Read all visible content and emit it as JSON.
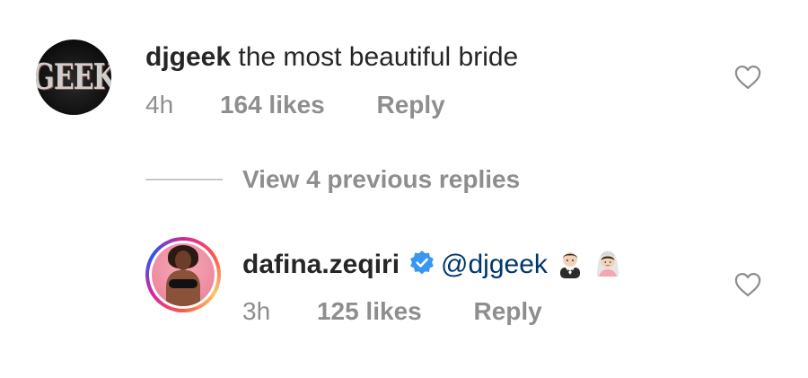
{
  "comments": [
    {
      "username": "djgeek",
      "text": "the most beautiful bride",
      "time": "4h",
      "likes": "164 likes",
      "reply": "Reply",
      "avatar_logo": "GEEK",
      "liked": false
    },
    {
      "username": "dafina.zeqiri",
      "verified": true,
      "mention": "@djgeek",
      "emojis": [
        "groom-emoji",
        "bride-with-veil-emoji"
      ],
      "time": "3h",
      "likes": "125 likes",
      "reply": "Reply",
      "liked": false
    }
  ],
  "replies_toggle": {
    "label": "View 4 previous replies"
  },
  "colors": {
    "username": "#262626",
    "meta": "#8e8e8e",
    "mention": "#00376b",
    "verified": "#3897f0",
    "divider": "#c7c7c7"
  }
}
